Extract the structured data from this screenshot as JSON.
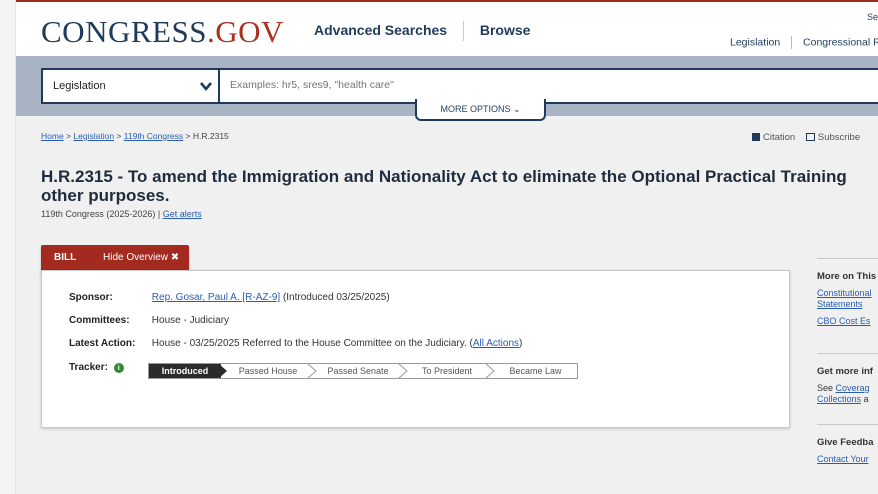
{
  "header": {
    "logo": {
      "main": "CONGRESS",
      "dot": ".",
      "suffix": "GOV"
    },
    "nav_main": [
      "Advanced Searches",
      "Browse"
    ],
    "top_right_link": "Se",
    "nav_secondary": [
      "Legislation",
      "Congressional R"
    ]
  },
  "search": {
    "selected_collection": "Legislation",
    "placeholder": "Examples: hr5, sres9, \"health care\"",
    "more_options": "MORE OPTIONS ⌄"
  },
  "breadcrumb": {
    "items": [
      "Home",
      "Legislation",
      "119th Congress"
    ],
    "separator": ">",
    "current": "H.R.2315"
  },
  "tools": {
    "citation": "Citation",
    "subscribe": "Subscribe"
  },
  "bill": {
    "title_line1": "H.R.2315 - To amend the Immigration and Nationality Act to eliminate the Optional Practical Training",
    "title_line2": "other purposes.",
    "congress": "119th Congress (2025-2026) |",
    "get_alerts": "Get alerts"
  },
  "overview_tab": {
    "label": "BILL",
    "toggle": "Hide Overview ✖"
  },
  "overview": {
    "sponsor_label": "Sponsor:",
    "sponsor_name": "Rep. Gosar, Paul A. [R-AZ-9]",
    "sponsor_intro": "(Introduced 03/25/2025)",
    "committees_label": "Committees:",
    "committees_value": "House - Judiciary",
    "latest_action_label": "Latest Action:",
    "latest_action_value": "House - 03/25/2025 Referred to the House Committee on the Judiciary.  (",
    "all_actions": "All Actions",
    "latest_action_close": ")",
    "tracker_label": "Tracker:",
    "tracker_info_icon": "i",
    "tracker_steps": [
      "Introduced",
      "Passed House",
      "Passed Senate",
      "To President",
      "Became Law"
    ]
  },
  "sidebar": {
    "sec1": {
      "head": "More on This",
      "link1": "Constitutional",
      "link2": "Statements",
      "link3": "CBO Cost Es"
    },
    "sec2": {
      "head": "Get more inf",
      "text_prefix": "See ",
      "link1": "Coverag",
      "link2": "Collections",
      "text_suffix": " a"
    },
    "sec3": {
      "head": "Give Feedba",
      "link1": "Contact Your"
    }
  },
  "colors": {
    "brand_navy": "#1f3b5c",
    "brand_red": "#a32a1f",
    "link_blue": "#2a5db0"
  }
}
